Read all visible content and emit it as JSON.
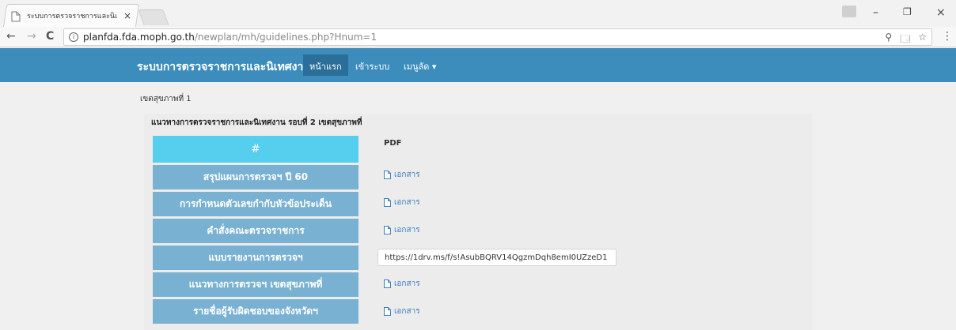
{
  "browser": {
    "tab_title": "ระบบการตรวจราชการและนิเ",
    "tab_close": "×",
    "window_minimize": "–",
    "window_restore": "❐",
    "window_close": "×",
    "url_host": "planfda.fda.moph.go.th",
    "url_path": "/newplan/mh/guidelines.php?Hnum=1",
    "nav_back": "←",
    "nav_forward": "→",
    "nav_reload": "C",
    "zoom_icon": "⚲",
    "translate_icon": "🗔",
    "bookmark_icon": "☆",
    "menu_icon": "⋮"
  },
  "site": {
    "brand": "ระบบการตรวจราชการและนิเทศงาน",
    "nav": [
      {
        "label": "หน้าแรก",
        "active": true
      },
      {
        "label": "เข้าระบบ",
        "active": false
      },
      {
        "label": "เมนูลัด ▾",
        "active": false
      }
    ]
  },
  "main": {
    "region_label": "เขตสุขภาพที่ 1",
    "heading": "แนวทางการตรวจราชการและนิเทศงาน รอบที่ 2 เขตสุขภาพที่",
    "menu_header": "#",
    "pdf_header": "PDF",
    "menu_items": [
      "สรุปแผนการตรวจฯ ปี 60",
      "การกำหนดตัวเลขกำกับหัวข้อประเด็น",
      "คำสั่งคณะตรวจราชการ",
      "แบบรายงานการตรวจฯ",
      "แนวทางการตรวจฯ เขตสุขภาพที่",
      "รายชื่อผู้รับผิดชอบของจังหวัดฯ"
    ],
    "doc_link_label": "เอกสาร",
    "report_url": "https://1drv.ms/f/s!AsubBQRV14QgzmDqh8emI0UZzeD1"
  }
}
